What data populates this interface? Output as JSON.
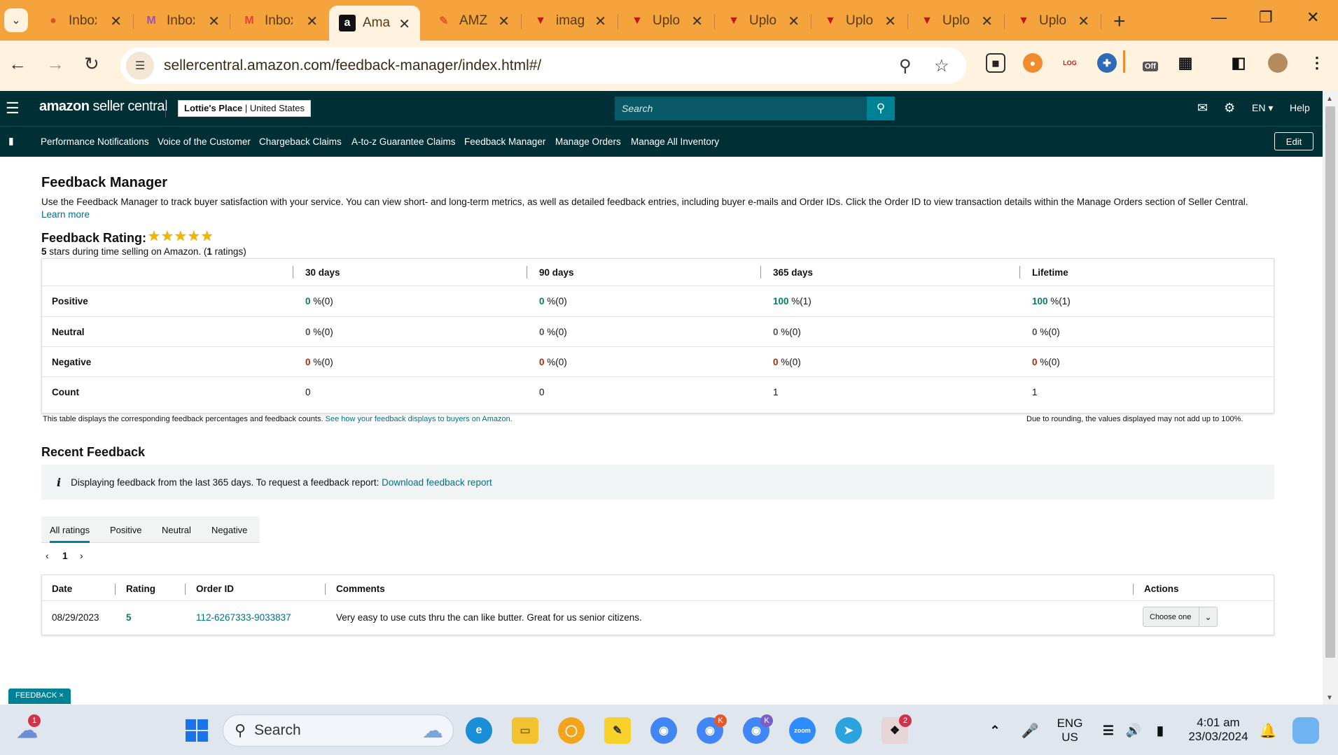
{
  "browser": {
    "tabs": [
      {
        "title": "Inbox",
        "icon": "mail-icon",
        "color": "#d4522c"
      },
      {
        "title": "Inbox",
        "icon": "mail-icon",
        "color": "#a34fbf"
      },
      {
        "title": "Inbox",
        "icon": "gmail-icon",
        "color": "#ea4335"
      },
      {
        "title": "Amazon",
        "icon": "amazon-icon",
        "color": "#000000",
        "active": true
      },
      {
        "title": "AMZ",
        "icon": "pen-icon",
        "color": "#e8572b"
      },
      {
        "title": "image",
        "icon": "pennant-icon",
        "color": "#c4161c"
      },
      {
        "title": "Upload",
        "icon": "pennant-icon",
        "color": "#c4161c"
      },
      {
        "title": "Upload",
        "icon": "pennant-icon",
        "color": "#c4161c"
      },
      {
        "title": "Upload",
        "icon": "pennant-icon",
        "color": "#c4161c"
      },
      {
        "title": "Upload",
        "icon": "pennant-icon",
        "color": "#c4161c"
      },
      {
        "title": "Upload",
        "icon": "pennant-icon",
        "color": "#c4161c"
      }
    ],
    "new_tab": "+",
    "url": "sellercentral.amazon.com/feedback-manager/index.html#/",
    "ext_off_label": "Off"
  },
  "header": {
    "logo_brand": "amazon",
    "logo_suffix": "seller central",
    "store_name": "Lottie's Place",
    "store_region": "United States",
    "search_placeholder": "Search",
    "lang": "EN",
    "help": "Help"
  },
  "nav": {
    "items": [
      "Performance Notifications",
      "Voice of the Customer",
      "Chargeback Claims",
      "A-to-z Guarantee Claims",
      "Feedback Manager",
      "Manage Orders",
      "Manage All Inventory"
    ],
    "edit": "Edit"
  },
  "page": {
    "title": "Feedback Manager",
    "desc": "Use the Feedback Manager to track buyer satisfaction with your service. You can view short- and long-term metrics, as well as detailed feedback entries, including buyer e-mails and Order IDs. Click the Order ID to view transaction details within the Manage Orders section of Seller Central.",
    "learn_more": "Learn more",
    "rating_title": "Feedback Rating:",
    "rating_stars": 5,
    "rating_value": "5",
    "rating_text_a": "stars during time selling on Amazon. (",
    "rating_count": "1",
    "rating_text_b": "ratings)",
    "metrics": {
      "columns": [
        "30 days",
        "90 days",
        "365 days",
        "Lifetime"
      ],
      "rows": [
        {
          "label": "Positive",
          "cells": [
            [
              "0",
              "%(0)"
            ],
            [
              "0",
              "%(0)"
            ],
            [
              "100",
              "%(1)"
            ],
            [
              "100",
              "%(1)"
            ]
          ]
        },
        {
          "label": "Neutral",
          "cells": [
            [
              "0",
              "%(0)"
            ],
            [
              "0",
              "%(0)"
            ],
            [
              "0",
              "%(0)"
            ],
            [
              "0",
              "%(0)"
            ]
          ]
        },
        {
          "label": "Negative",
          "cells": [
            [
              "0",
              "%(0)"
            ],
            [
              "0",
              "%(0)"
            ],
            [
              "0",
              "%(0)"
            ],
            [
              "0",
              "%(0)"
            ]
          ]
        },
        {
          "label": "Count",
          "cells": [
            [
              "0",
              ""
            ],
            [
              "0",
              ""
            ],
            [
              "1",
              ""
            ],
            [
              "1",
              ""
            ]
          ]
        }
      ]
    },
    "note_left": "This table displays the corresponding feedback percentages and feedback counts.",
    "note_left_link": "See how your feedback displays to buyers on Amazon.",
    "note_right": "Due to rounding, the values displayed may not add up to 100%.",
    "recent_title": "Recent Feedback",
    "info_text": "Displaying feedback from the last 365 days. To request a feedback report:",
    "info_link": "Download feedback report",
    "tabs": [
      "All ratings",
      "Positive",
      "Neutral",
      "Negative"
    ],
    "page_num": "1",
    "fb_columns": [
      "Date",
      "Rating",
      "Order ID",
      "Comments",
      "Actions"
    ],
    "fb_rows": [
      {
        "date": "08/29/2023",
        "rating": "5",
        "order_id": "112-6267333-9033837",
        "comment": "Very easy to use cuts thru the can like butter. Great for us senior citizens.",
        "action": "Choose one"
      }
    ],
    "feedback_badge": "FEEDBACK ×"
  },
  "taskbar": {
    "search": "Search",
    "lang_top": "ENG",
    "lang_bottom": "US",
    "time": "4:01 am",
    "date": "23/03/2024",
    "weather_badge": "1",
    "chrome_k1": "K",
    "chrome_k2": "K",
    "zoom_label": "zoom",
    "slack_badge": "2"
  },
  "colors": {
    "tabbar": "#f4a33d",
    "header": "#002f36",
    "accent": "#008296",
    "positive": "#067d62",
    "negative": "#b12704"
  }
}
